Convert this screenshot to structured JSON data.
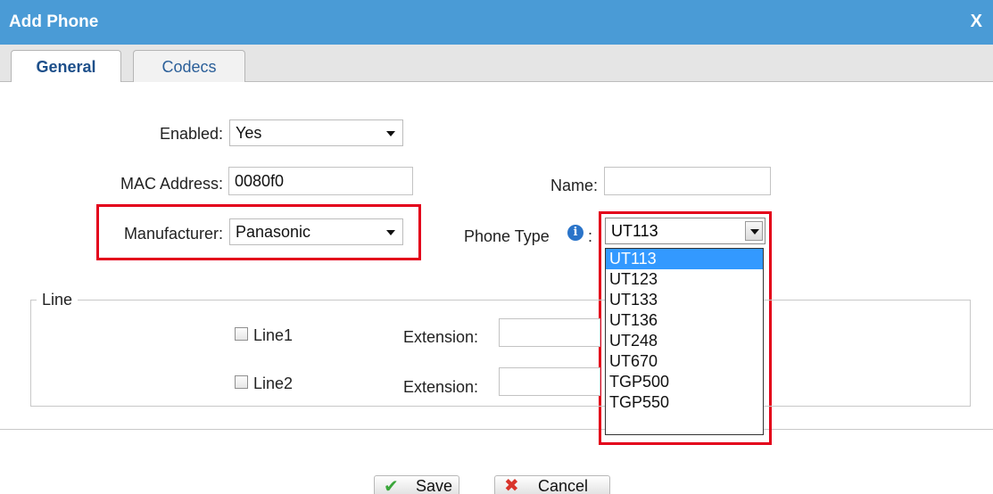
{
  "dialog": {
    "title": "Add Phone",
    "close_label": "X"
  },
  "tabs": [
    {
      "label": "General"
    },
    {
      "label": "Codecs"
    }
  ],
  "form": {
    "enabled": {
      "label": "Enabled:",
      "value": "Yes"
    },
    "mac": {
      "label": "MAC Address:",
      "value": "0080f0"
    },
    "name": {
      "label": "Name:",
      "value": ""
    },
    "manufacturer": {
      "label": "Manufacturer:",
      "value": "Panasonic"
    },
    "phone_type": {
      "label": "Phone Type",
      "suffix": ":",
      "value": "UT113",
      "options": [
        "UT113",
        "UT123",
        "UT133",
        "UT136",
        "UT248",
        "UT670",
        "TGP500",
        "TGP550"
      ]
    }
  },
  "line_group": {
    "legend": "Line",
    "lines": [
      {
        "label": "Line1",
        "extension_label": "Extension:",
        "extension_value": ""
      },
      {
        "label": "Line2",
        "extension_label": "Extension:",
        "extension_value": ""
      }
    ]
  },
  "buttons": {
    "save": "Save",
    "cancel": "Cancel"
  },
  "colors": {
    "title_bar": "#4a9bd6",
    "highlight_box": "#e3001b",
    "selected_option": "#3399ff"
  },
  "icons": {
    "close": "close-icon",
    "info": "info-icon",
    "save": "checkmark-icon",
    "cancel": "cross-icon"
  }
}
